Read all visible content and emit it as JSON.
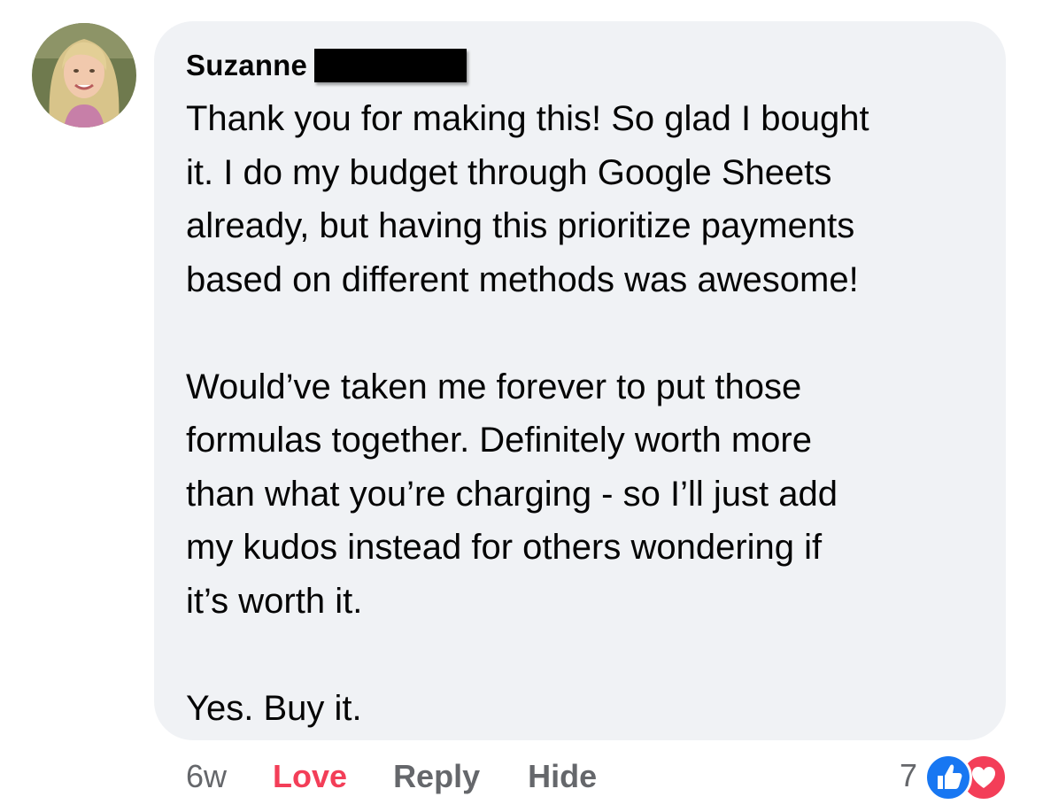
{
  "comment": {
    "author": "Suzanne",
    "text": "Thank you for making this! So glad I bought\nit. I do my budget through Google Sheets\nalready, but having this prioritize payments\nbased on different methods was awesome!\n\nWould’ve taken me forever to put those\nformulas together. Definitely worth more\nthan what you’re charging - so I’ll just add\nmy kudos instead for others wondering if\nit’s worth it.\n\nYes. Buy it."
  },
  "actions": {
    "age": "6w",
    "love": "Love",
    "reply": "Reply",
    "hide": "Hide"
  },
  "reactions": {
    "count": "7",
    "icons": [
      "like-icon",
      "love-icon"
    ]
  },
  "colors": {
    "bubble": "#f0f2f5",
    "love": "#f33e58",
    "like": "#1877f2",
    "muted": "#65676b"
  }
}
